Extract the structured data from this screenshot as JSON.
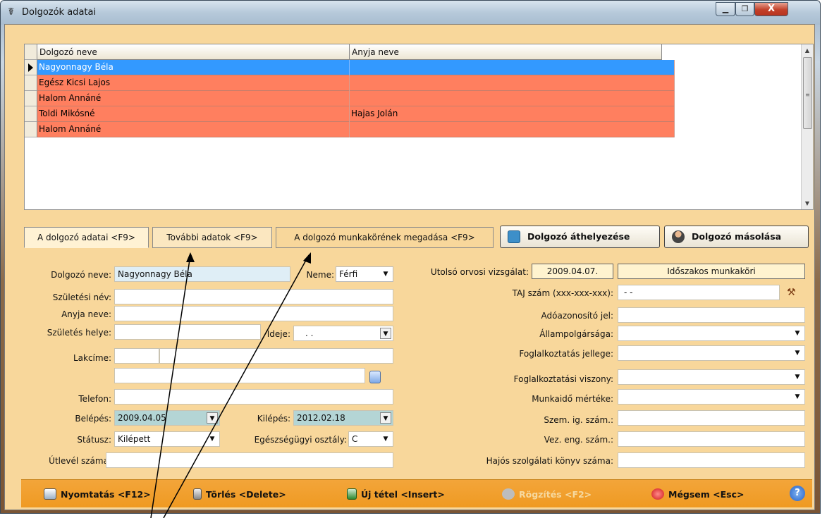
{
  "window": {
    "title": "Dolgozók adatai",
    "min": "▁",
    "max": "❐",
    "close": "X"
  },
  "grid": {
    "headers": [
      "Dolgozó neve",
      "Anyja neve"
    ],
    "rows": [
      {
        "name": "Nagyonnagy Béla",
        "mother": "",
        "selected": true
      },
      {
        "name": "Egész Kicsi Lajos",
        "mother": ""
      },
      {
        "name": "Halom Annáné",
        "mother": ""
      },
      {
        "name": "Toldi Mikósné",
        "mother": "Hajas Jolán"
      },
      {
        "name": "Halom Annáné",
        "mother": ""
      }
    ],
    "colors": {
      "selected": "#3399ff",
      "row": "#ff7f5f"
    }
  },
  "tabs": [
    "A dolgozó adatai <F9>",
    "További adatok <F9>",
    "A dolgozó munkakörének megadása <F9>"
  ],
  "buttons": {
    "transfer": "Dolgozó áthelyezése",
    "copy": "Dolgozó másolása"
  },
  "form": {
    "name_label": "Dolgozó neve:",
    "name_value": "Nagyonnagy Béla",
    "sex_label": "Neme:",
    "sex_value": "Férfi",
    "birthname_label": "Születési név:",
    "mother_label": "Anyja neve:",
    "birthplace_label": "Születés helye:",
    "birthdate_label": "Ideje:",
    "birthdate_value": ". .",
    "address_label": "Lakcíme:",
    "phone_label": "Telefon:",
    "entry_label": "Belépés:",
    "entry_value": "2009.04.05",
    "exit_label": "Kilépés:",
    "exit_value": "2012.02.18",
    "status_label": "Státusz:",
    "status_value": "Kilépett",
    "health_label": "Egészségügyi osztály:",
    "health_value": "C",
    "passport_label": "Útlevél száma:",
    "medical_label": "Utolsó orvosi vizsgálat:",
    "medical_value": "2009.04.07.",
    "medical_type": "Időszakos munkaköri",
    "taj_label": "TAJ szám (xxx-xxx-xxx):",
    "taj_value": "- -",
    "tax_label": "Adóazonosító jel:",
    "citizenship_label": "Állampolgársága:",
    "employment_label": "Foglalkoztatás jellege:",
    "relation_label": "Foglalkoztatási viszony:",
    "worktime_label": "Munkaidő mértéke:",
    "id_label": "Szem. ig. szám.:",
    "license_label": "Vez. eng. szám.:",
    "seaman_label": "Hajós szolgálati könyv száma:"
  },
  "toolbar": {
    "print": "Nyomtatás <F12>",
    "delete": "Törlés <Delete>",
    "new": "Új tétel <Insert>",
    "save": "Rögzítés <F2>",
    "cancel": "Mégsem <Esc>",
    "help": "?"
  }
}
